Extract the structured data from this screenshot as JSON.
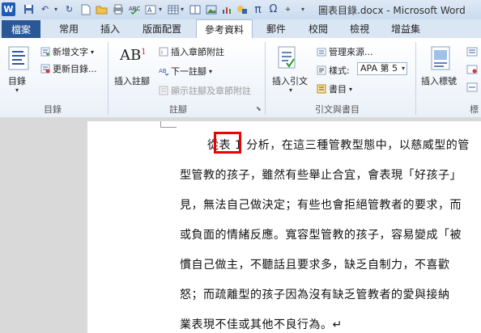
{
  "titlebar": {
    "app_logo": "W",
    "title": "圖表目錄.docx - Microsoft Word",
    "quick_access_icons": [
      "save-icon",
      "undo-icon",
      "undo-dropdown-icon",
      "redo-icon",
      "new-document-icon",
      "open-folder-icon",
      "print-preview-icon",
      "spelling-check-icon",
      "insert-text-box-icon",
      "insert-table-icon",
      "insert-picture-icon",
      "insert-equation-icon",
      "insert-symbol-icon",
      "customize-qat-icon"
    ]
  },
  "tabs": {
    "file": "檔案",
    "items": [
      "常用",
      "插入",
      "版面配置",
      "參考資料",
      "郵件",
      "校閱",
      "檢視",
      "增益集"
    ],
    "active": "參考資料"
  },
  "ribbon": {
    "toc_group": {
      "toc_button": "目錄",
      "add_text": "新增文字",
      "update_toc": "更新目錄...",
      "label": "目錄"
    },
    "footnotes_group": {
      "insert_footnote": "插入註腳",
      "insert_endnote": "插入章節附註",
      "next_footnote": "下一註腳",
      "show_notes": "顯示註腳及章節附註",
      "label": "註腳"
    },
    "citations_group": {
      "insert_citation": "插入引文",
      "manage_sources": "管理來源...",
      "style_label": "樣式:",
      "style_value": "APA 第 5",
      "bibliography": "書目",
      "label": "引文與書目"
    },
    "captions_group": {
      "insert_caption": "插入標號",
      "label": "標"
    }
  },
  "document": {
    "lines": [
      "從表 1 分析，在這三種管教型態中，以慈威型的管",
      "型管教的孩子，雖然有些舉止合宜，會表現「好孩子」",
      "見，無法自己做決定；有些也會拒絕管教者的要求，而",
      "或負面的情緒反應。寬容型管教的孩子，容易變成「被",
      "慣自己做主，不聽話且要求多，缺乏自制力，不喜歡",
      "怒；而疏離型的孩子因為沒有缺乏管教者的愛與接納",
      "業表現不佳或其他不良行為。↵"
    ]
  },
  "colors": {
    "file_tab": "#2b5797",
    "highlight_box": "#e00000"
  }
}
